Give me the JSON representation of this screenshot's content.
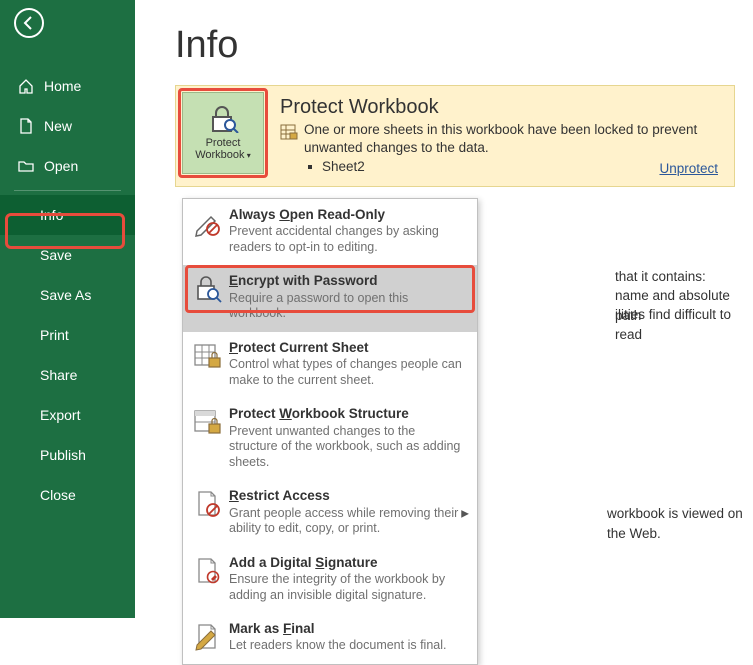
{
  "page_title": "Info",
  "sidebar": {
    "home": "Home",
    "new": "New",
    "open": "Open",
    "info": "Info",
    "save": "Save",
    "save_as": "Save As",
    "print": "Print",
    "share": "Share",
    "export": "Export",
    "publish": "Publish",
    "close": "Close"
  },
  "protect_card": {
    "button_label_1": "Protect",
    "button_label_2": "Workbook",
    "title": "Protect Workbook",
    "message": "One or more sheets in this workbook have been locked to prevent unwanted changes to the data.",
    "sheet": "Sheet2",
    "unprotect": "Unprotect"
  },
  "bg": {
    "line1": "that it contains:",
    "line2": "name and absolute path",
    "line3": "ilities find difficult to read",
    "line4": "workbook is viewed on the Web."
  },
  "dropdown": {
    "items": [
      {
        "title_pre": "Always ",
        "ul": "O",
        "title_post": "pen Read-Only",
        "desc": "Prevent accidental changes by asking readers to opt-in to editing."
      },
      {
        "title_pre": "",
        "ul": "E",
        "title_post": "ncrypt with Password",
        "desc": "Require a password to open this workbook."
      },
      {
        "title_pre": "",
        "ul": "P",
        "title_post": "rotect Current Sheet",
        "desc": "Control what types of changes people can make to the current sheet."
      },
      {
        "title_pre": "Protect ",
        "ul": "W",
        "title_post": "orkbook Structure",
        "desc": "Prevent unwanted changes to the structure of the workbook, such as adding sheets."
      },
      {
        "title_pre": "",
        "ul": "R",
        "title_post": "estrict Access",
        "desc": "Grant people access while removing their ability to edit, copy, or print."
      },
      {
        "title_pre": "Add a Digital ",
        "ul": "S",
        "title_post": "ignature",
        "desc": "Ensure the integrity of the workbook by adding an invisible digital signature."
      },
      {
        "title_pre": "Mark as ",
        "ul": "F",
        "title_post": "inal",
        "desc": "Let readers know the document is final."
      }
    ]
  }
}
